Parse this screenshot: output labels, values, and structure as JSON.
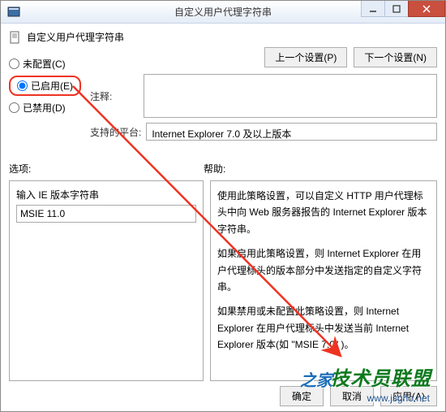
{
  "window": {
    "title": "自定义用户代理字符串",
    "heading": "自定义用户代理字符串"
  },
  "nav": {
    "prev": "上一个设置(P)",
    "next": "下一个设置(N)"
  },
  "radios": {
    "not_configured": "未配置(C)",
    "enabled": "已启用(E)",
    "disabled": "已禁用(D)",
    "selected": "enabled"
  },
  "fields": {
    "comment_label": "注释:",
    "comment_value": "",
    "platform_label": "支持的平台:",
    "platform_value": "Internet Explorer 7.0 及以上版本"
  },
  "sections": {
    "options_label": "选项:",
    "help_label": "帮助:"
  },
  "options": {
    "input_label": "输入 IE 版本字符串",
    "input_value": "MSIE 11.0"
  },
  "help": {
    "p1": "使用此策略设置，可以自定义 HTTP 用户代理标头中向 Web 服务器报告的 Internet Explorer 版本字符串。",
    "p2": "如果启用此策略设置，则 Internet Explorer 在用户代理标头的版本部分中发送指定的自定义字符串。",
    "p3": "如果禁用或未配置此策略设置，则 Internet Explorer 在用户代理标头中发送当前 Internet Explorer 版本(如 \"MSIE 7.0\" )。"
  },
  "footer": {
    "ok": "确定",
    "cancel": "取消",
    "apply": "应用(A)"
  },
  "watermark": {
    "main": "技术员联盟",
    "blue": "之家",
    "url": "www.jsgho.net"
  }
}
